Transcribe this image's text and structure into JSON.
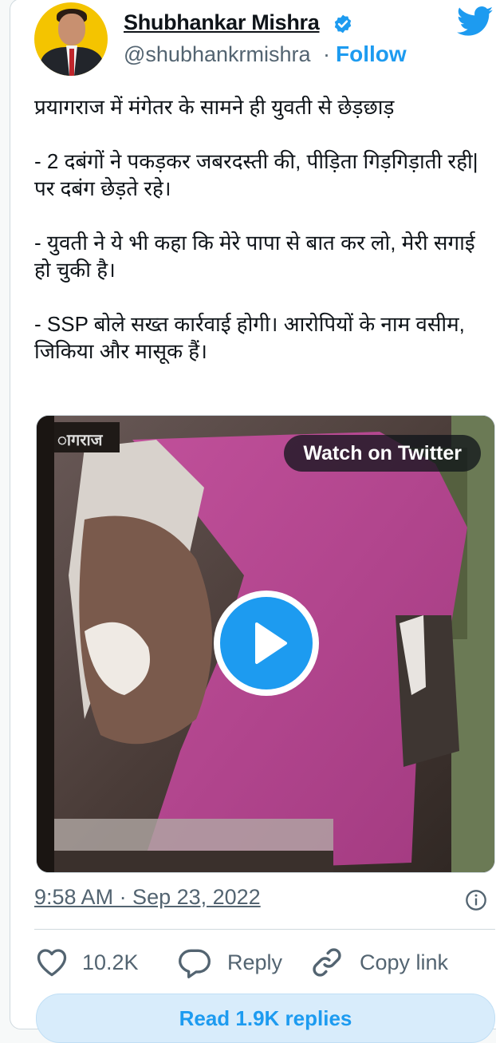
{
  "tweet": {
    "author_name": "Shubhankar Mishra",
    "handle": "@shubhankrmishra",
    "separator": "·",
    "follow_label": "Follow",
    "text": "प्रयागराज में मंगेतर के सामने ही युवती से छेड़छाड़\n\n- 2 दबंगों ने पकड़कर जबरदस्ती की, पीड़िता गिड़गिड़ाती रही| पर दबंग छेड़ते रहे।\n\n- युवती ने ये भी कहा कि मेरे पापा से बात कर लो, मेरी सगाई हो चुकी है।\n\n- SSP बोले सख्त कार्रवाई होगी। आरोपियों के नाम वसीम, जिकिया और मासूक हैं।",
    "timestamp": "9:58 AM · Sep 23, 2022"
  },
  "media": {
    "watermark": "ागराज",
    "watch_label": "Watch on Twitter"
  },
  "actions": {
    "likes": "10.2K",
    "reply_label": "Reply",
    "copy_link_label": "Copy link"
  },
  "read_replies_label": "Read 1.9K replies",
  "colors": {
    "accent": "#1d9bf0",
    "secondary_text": "#536471",
    "border": "#cfd9de"
  },
  "icons": [
    "verified-badge-icon",
    "twitter-bird-icon",
    "play-icon",
    "info-icon",
    "heart-icon",
    "reply-icon",
    "link-icon"
  ]
}
